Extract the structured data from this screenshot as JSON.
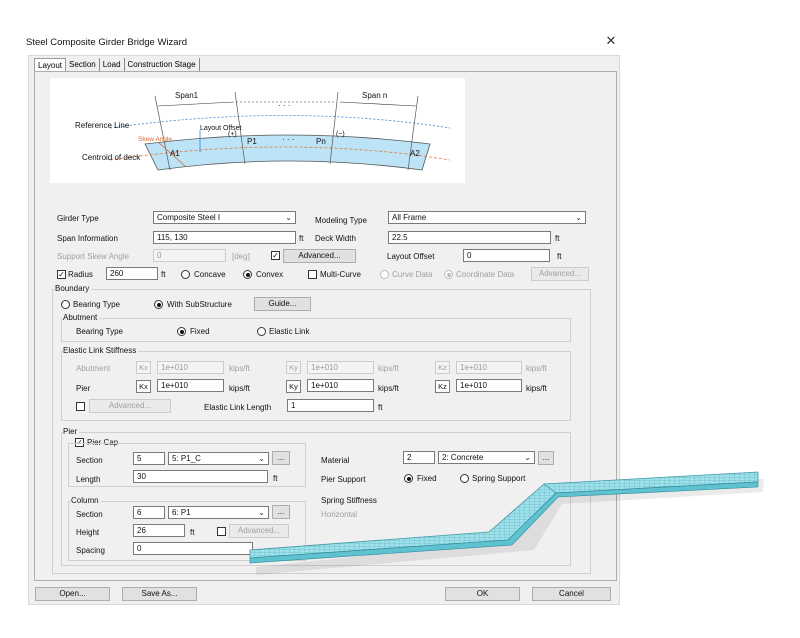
{
  "window": {
    "title": "Steel Composite Girder Bridge Wizard",
    "close_glyph": "✕"
  },
  "tabs": [
    {
      "label": "Layout"
    },
    {
      "label": "Section"
    },
    {
      "label": "Load"
    },
    {
      "label": "Construction Stage"
    }
  ],
  "diagram": {
    "span1": "Span1",
    "dots": "· · ·",
    "span_n": "Span n",
    "reference_line": "Reference Line",
    "centroid": "Centroid of deck",
    "skew_angle": "Skew Angle",
    "layout_offset": "Layout Offset",
    "plus": "(+)",
    "minus": "(−)",
    "a1": "A1",
    "p1": "P1",
    "pn": "Pn",
    "a2": "A2"
  },
  "girder_type": {
    "label": "Girder Type",
    "value": "Composite Steel I"
  },
  "modeling_type": {
    "label": "Modeling Type",
    "value": "All Frame"
  },
  "span_info": {
    "label": "Span Information",
    "value": "115, 130",
    "unit": "ft"
  },
  "deck_width": {
    "label": "Deck Width",
    "value": "22.5",
    "unit": "ft"
  },
  "support_skew": {
    "label": "Support Skew Angle",
    "value": "0",
    "unit": "[deg]"
  },
  "advanced1": "Advanced...",
  "layout_offset": {
    "label": "Layout Offset",
    "value": "0",
    "unit": "ft"
  },
  "radius": {
    "label": "Radius",
    "value": "260",
    "unit": "ft"
  },
  "concave": "Concave",
  "convex": "Convex",
  "multi_curve": "Multi-Curve",
  "curve_data": "Curve Data",
  "coordinate_data": "Coordinate Data",
  "advanced2": "Advanced...",
  "boundary": {
    "title": "Boundary",
    "bearing_type": "Bearing Type",
    "with_substructure": "With SubStructure",
    "guide": "Guide...",
    "abutment": {
      "title": "Abutment",
      "bearing_type": "Bearing Type",
      "fixed": "Fixed",
      "elastic_link": "Elastic Link"
    },
    "elastic": {
      "title": "Elastic Link Stiffness",
      "abutment": "Abutment",
      "pier": "Pier",
      "kx": "Kx",
      "ky": "Ky",
      "kz": "Kz",
      "value": "1e+010",
      "unit": "kips/ft",
      "advanced": "Advanced...",
      "link_length_label": "Elastic Link Length",
      "link_length": "1",
      "link_unit": "ft"
    }
  },
  "pier": {
    "title": "Pier",
    "pier_cap": "Pier Cap",
    "section_label": "Section",
    "section_no": "5",
    "section_name": "5: P1_C",
    "length_label": "Length",
    "length": "30",
    "length_unit": "ft",
    "ellipsis": "...",
    "material_label": "Material",
    "material_no": "2",
    "material_name": "2: Concrete",
    "pier_support": "Pier Support",
    "fixed": "Fixed",
    "spring_support": "Spring Support"
  },
  "column": {
    "title": "Column",
    "section_label": "Section",
    "section_no": "6",
    "section_name": "6: P1",
    "height_label": "Height",
    "height": "26",
    "height_unit": "ft",
    "advanced": "Advanced...",
    "spacing_label": "Spacing",
    "spacing": "0"
  },
  "spring": {
    "title": "Spring Stiffness",
    "horizontal": "Horizontal"
  },
  "buttons": {
    "open": "Open...",
    "save_as": "Save As...",
    "ok": "OK",
    "cancel": "Cancel"
  }
}
